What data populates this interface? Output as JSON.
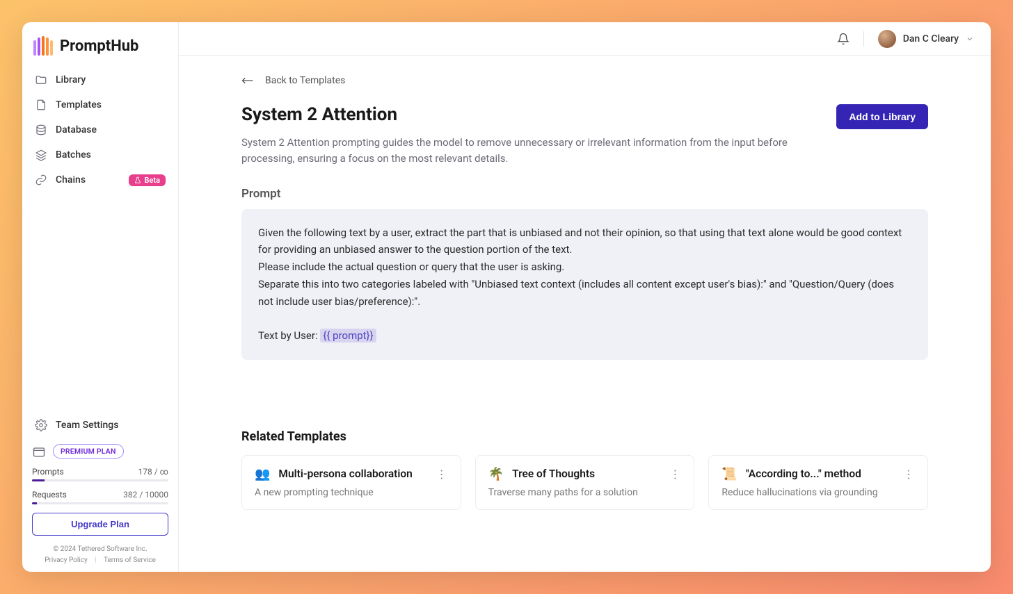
{
  "brand": {
    "name": "PromptHub"
  },
  "sidebar": {
    "items": [
      {
        "label": "Library"
      },
      {
        "label": "Templates"
      },
      {
        "label": "Database"
      },
      {
        "label": "Batches"
      },
      {
        "label": "Chains",
        "badge": "Beta"
      }
    ],
    "team_settings_label": "Team Settings",
    "plan": {
      "tier": "PREMIUM PLAN",
      "prompts_label": "Prompts",
      "prompts_value": "178 / ∞",
      "requests_label": "Requests",
      "requests_value": "382 / 10000",
      "requests_pct": 3.82,
      "upgrade_label": "Upgrade Plan"
    },
    "footer": {
      "copyright": "© 2024 Tethered Software Inc.",
      "privacy": "Privacy Policy",
      "terms": "Terms of Service"
    }
  },
  "header": {
    "user_name": "Dan C Cleary"
  },
  "page": {
    "back_label": "Back to Templates",
    "title": "System 2 Attention",
    "add_label": "Add to Library",
    "description": "System 2 Attention prompting guides the model to remove unnecessary or irrelevant information from the input before processing, ensuring a focus on the most relevant details.",
    "prompt_heading": "Prompt",
    "prompt_body_1": "Given the following text by a user, extract the part that is unbiased and not their opinion, so that using that text alone would be good context for providing an unbiased answer to the question portion of the text.",
    "prompt_body_2": "Please include the actual question or query that the user is asking.",
    "prompt_body_3": "Separate this into two categories labeled with \"Unbiased text context (includes all content except user's bias):\" and \"Question/Query (does not include user bias/preference):\".",
    "prompt_body_4_prefix": "Text by User: ",
    "prompt_var": "{{ prompt}}",
    "related_heading": "Related Templates",
    "related": [
      {
        "emoji": "👥",
        "title": "Multi-persona collaboration",
        "desc": "A new prompting technique"
      },
      {
        "emoji": "🌴",
        "title": "Tree of Thoughts",
        "desc": "Traverse many paths for a solution"
      },
      {
        "emoji": "📜",
        "title": "\"According to...\" method",
        "desc": "Reduce hallucinations via grounding"
      }
    ]
  }
}
